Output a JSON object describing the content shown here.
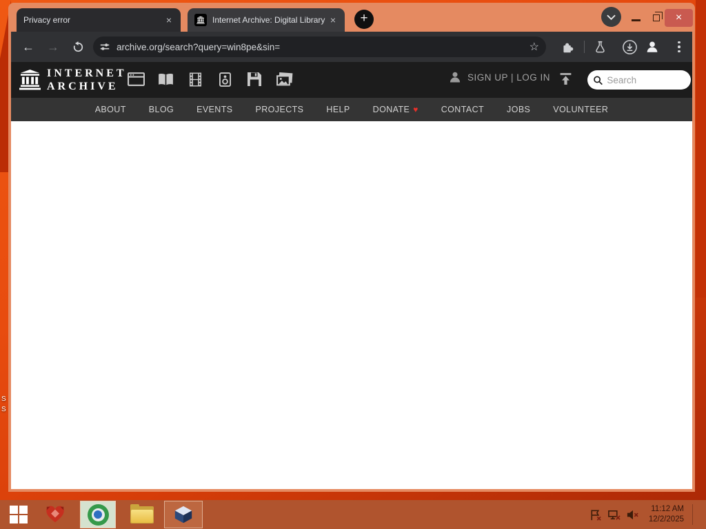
{
  "browser": {
    "tabs": [
      {
        "title": "Privacy error"
      },
      {
        "title": "Internet Archive: Digital Library"
      }
    ],
    "address_bar": {
      "url": "archive.org/search?query=win8pe&sin="
    }
  },
  "glyphs": {
    "close_tab": "×",
    "new_tab": "+",
    "back": "←",
    "forward": "→",
    "bookmark_star": "☆",
    "window_close": "×",
    "heart": "♥"
  },
  "ia": {
    "logo": {
      "line1": "INTERNET",
      "line2": "ARCHIVE"
    },
    "auth": {
      "label": "SIGN UP | LOG IN"
    },
    "search": {
      "placeholder": "Search"
    },
    "nav": {
      "items": [
        "ABOUT",
        "BLOG",
        "EVENTS",
        "PROJECTS",
        "HELP",
        "DONATE",
        "CONTACT",
        "JOBS",
        "VOLUNTEER"
      ]
    },
    "media_types": [
      "web",
      "texts",
      "video",
      "audio",
      "software",
      "images"
    ]
  },
  "desktop": {
    "icon_label_fragments": [
      "S",
      "S"
    ]
  },
  "taskbar": {
    "clock": {
      "time": "11:12 AM",
      "date": "12/2/2025"
    },
    "apps": [
      "start",
      "localsend",
      "chrome",
      "file-explorer",
      "virtualbox"
    ],
    "tray": [
      "flag-alert",
      "network-disconnected",
      "volume-muted"
    ]
  },
  "colors": {
    "wallpaper": "#e84c0f",
    "window_frame": "#e58a61",
    "toolbar": "#303134",
    "urlbar": "#202124",
    "ia_header": "#1c1c1c",
    "ia_nav": "#343434",
    "taskbar": "#b0542e",
    "close_button": "#c95a50",
    "donate_heart": "#e9302a"
  }
}
